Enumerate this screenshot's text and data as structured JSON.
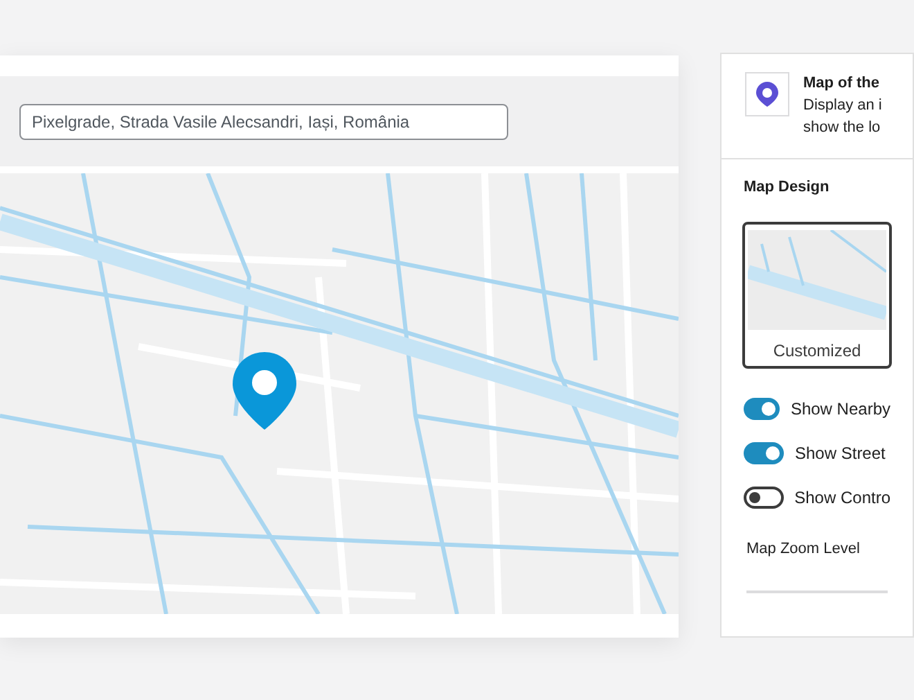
{
  "location_field": {
    "value": "Pixelgrade, Strada Vasile Alecsandri, Iași, România"
  },
  "block": {
    "title": "Map of the",
    "description_lines": [
      "Display an i",
      "show the lo"
    ]
  },
  "map_design": {
    "heading": "Map Design",
    "styles": [
      {
        "label": "Customized",
        "selected": true
      }
    ]
  },
  "toggles": [
    {
      "label": "Show Nearby",
      "on": true
    },
    {
      "label": "Show Street",
      "on": true
    },
    {
      "label": "Show Contro",
      "on": false
    }
  ],
  "zoom": {
    "label": "Map Zoom Level"
  }
}
